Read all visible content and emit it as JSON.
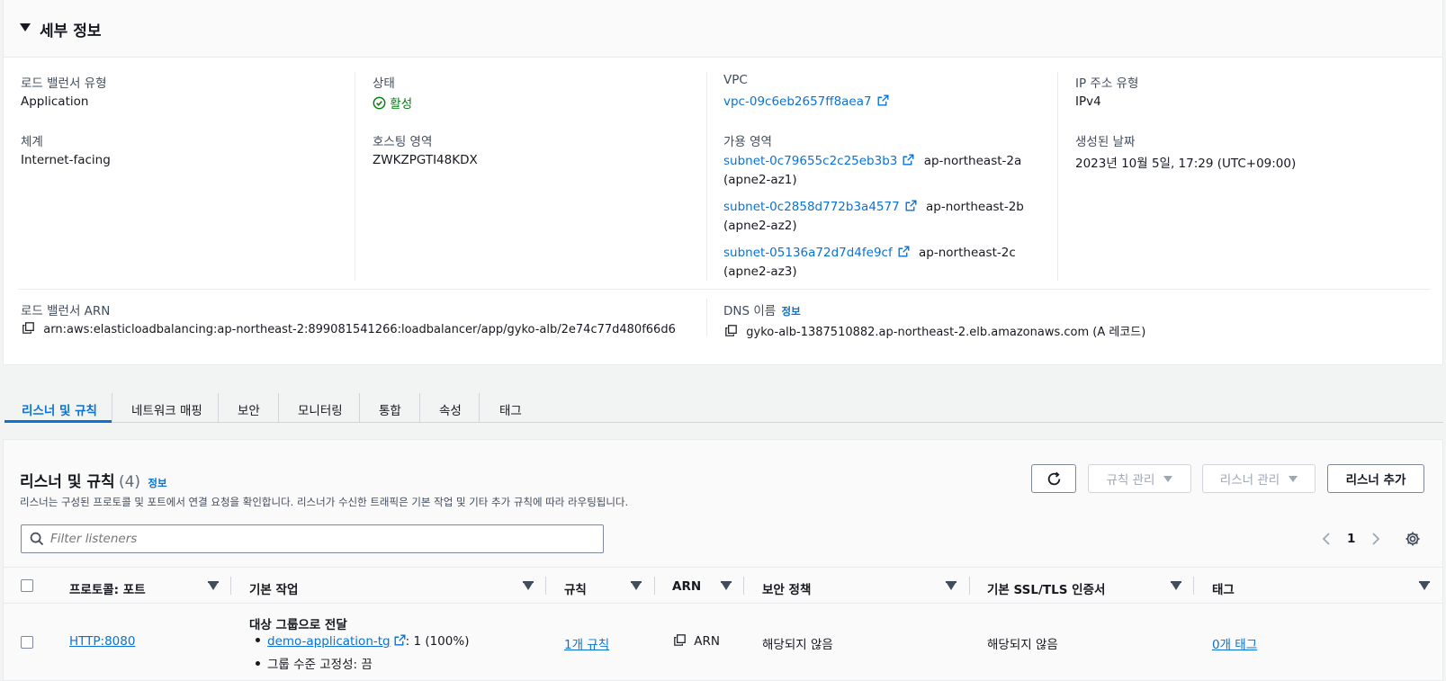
{
  "details": {
    "title": "세부 정보",
    "lb_type_label": "로드 밸런서 유형",
    "lb_type_value": "Application",
    "status_label": "상태",
    "status_value": "활성",
    "vpc_label": "VPC",
    "vpc_value": "vpc-09c6eb2657ff8aea7",
    "ip_type_label": "IP 주소 유형",
    "ip_type_value": "IPv4",
    "scheme_label": "체계",
    "scheme_value": "Internet-facing",
    "hosted_zone_label": "호스팅 영역",
    "hosted_zone_value": "ZWKZPGTI48KDX",
    "az_label": "가용 영역",
    "subnets": [
      {
        "id": "subnet-0c79655c2c25eb3b3",
        "zone": "ap-northeast-2a",
        "az": "(apne2-az1)"
      },
      {
        "id": "subnet-0c2858d772b3a4577",
        "zone": "ap-northeast-2b",
        "az": "(apne2-az2)"
      },
      {
        "id": "subnet-05136a72d7d4fe9cf",
        "zone": "ap-northeast-2c",
        "az": "(apne2-az3)"
      }
    ],
    "created_label": "생성된 날짜",
    "created_value": "2023년 10월 5일, 17:29 (UTC+09:00)",
    "arn_label": "로드 밸런서 ARN",
    "arn_value": "arn:aws:elasticloadbalancing:ap-northeast-2:899081541266:loadbalancer/app/gyko-alb/2e74c77d480f66d6",
    "dns_label": "DNS 이름",
    "dns_info": "정보",
    "dns_value": "gyko-alb-1387510882.ap-northeast-2.elb.amazonaws.com (A 레코드)"
  },
  "tabs": [
    {
      "label": "리스너 및 규칙",
      "active": true
    },
    {
      "label": "네트워크 매핑"
    },
    {
      "label": "보안"
    },
    {
      "label": "모니터링"
    },
    {
      "label": "통합"
    },
    {
      "label": "속성"
    },
    {
      "label": "태그"
    }
  ],
  "listeners": {
    "title": "리스너 및 규칙",
    "count": "(4)",
    "info": "정보",
    "description": "리스너는 구성된 프로토콜 및 포트에서 연결 요청을 확인합니다. 리스너가 수신한 트래픽은 기본 작업 및 기타 추가 규칙에 따라 라우팅됩니다.",
    "manage_rules": "규칙 관리",
    "manage_listener": "리스너 관리",
    "add_listener": "리스너 추가",
    "search_placeholder": "Filter listeners",
    "page": "1",
    "columns": [
      "프로토콜: 포트",
      "기본 작업",
      "규칙",
      "ARN",
      "보안 정책",
      "기본 SSL/TLS 인증서",
      "태그"
    ],
    "rows": [
      {
        "protocol": "HTTP:8080",
        "action_title": "대상 그룹으로 전달",
        "target_group": "demo-application-tg",
        "target_weight": ": 1 (100%)",
        "stickiness": "그룹 수준 고정성: 끔",
        "rules": "1개 규칙",
        "arn": "ARN",
        "security_policy": "해당되지 않음",
        "ssl_cert": "해당되지 않음",
        "tags": "0개 태그"
      }
    ]
  },
  "colors": {
    "link": "#0972d3",
    "success": "#037f0c",
    "text": "#16191f"
  }
}
